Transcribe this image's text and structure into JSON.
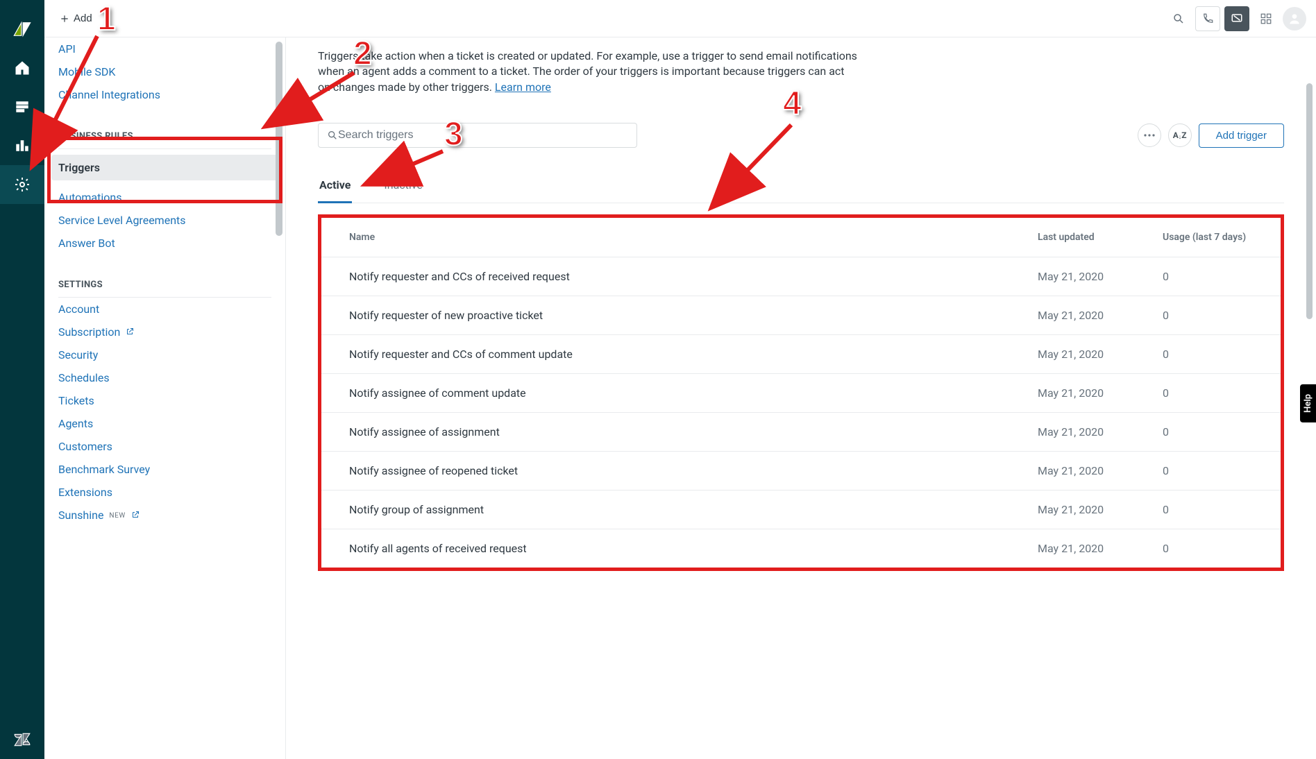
{
  "topbar": {
    "add_label": "Add"
  },
  "sidebar": {
    "top_links": [
      "API",
      "Mobile SDK",
      "Channel Integrations"
    ],
    "section_business": "BUSINESS RULES",
    "business_items": [
      "Triggers",
      "Automations",
      "Service Level Agreements",
      "Answer Bot"
    ],
    "section_settings": "SETTINGS",
    "settings_items": [
      "Account",
      "Subscription",
      "Security",
      "Schedules",
      "Tickets",
      "Agents",
      "Customers",
      "Benchmark Survey",
      "Extensions",
      "Sunshine"
    ],
    "settings_external": {
      "Subscription": true,
      "Sunshine": true
    },
    "new_badge_label": "NEW"
  },
  "content": {
    "description": "Triggers take action when a ticket is created or updated. For example, use a trigger to send email notifications when an agent adds a comment to a ticket. The order of your triggers is important because triggers can act on changes made by other triggers.",
    "learn_more": "Learn more",
    "search_placeholder": "Search triggers",
    "add_trigger_label": "Add trigger",
    "tabs": {
      "active": "Active",
      "inactive": "Inactive"
    },
    "table": {
      "headers": {
        "name": "Name",
        "updated": "Last updated",
        "usage": "Usage (last 7 days)"
      },
      "rows": [
        {
          "name": "Notify requester and CCs of received request",
          "updated": "May 21, 2020",
          "usage": "0"
        },
        {
          "name": "Notify requester of new proactive ticket",
          "updated": "May 21, 2020",
          "usage": "0"
        },
        {
          "name": "Notify requester and CCs of comment update",
          "updated": "May 21, 2020",
          "usage": "0"
        },
        {
          "name": "Notify assignee of comment update",
          "updated": "May 21, 2020",
          "usage": "0"
        },
        {
          "name": "Notify assignee of assignment",
          "updated": "May 21, 2020",
          "usage": "0"
        },
        {
          "name": "Notify assignee of reopened ticket",
          "updated": "May 21, 2020",
          "usage": "0"
        },
        {
          "name": "Notify group of assignment",
          "updated": "May 21, 2020",
          "usage": "0"
        },
        {
          "name": "Notify all agents of received request",
          "updated": "May 21, 2020",
          "usage": "0"
        }
      ]
    }
  },
  "annotations": {
    "m1": "1",
    "m2": "2",
    "m3": "3",
    "m4": "4"
  },
  "help_label": "Help"
}
